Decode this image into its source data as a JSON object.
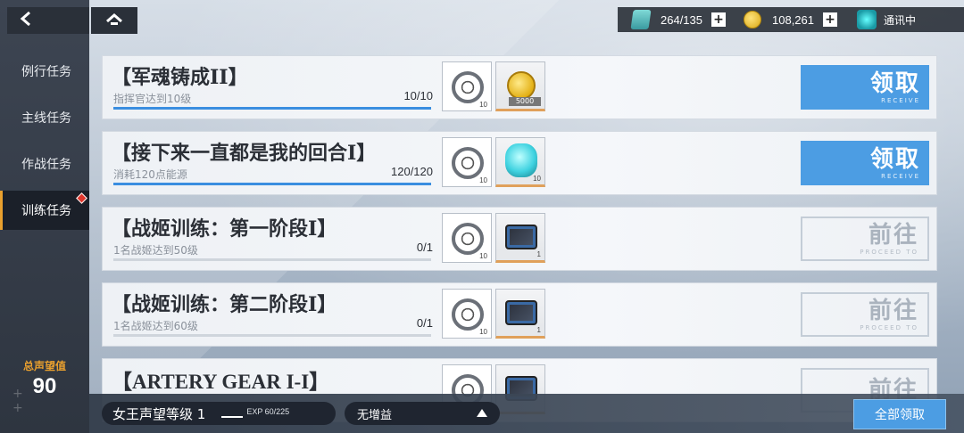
{
  "nav": {
    "back_icon": "chevron-left-icon",
    "home_icon": "chevron-up-icon",
    "items": [
      {
        "label": "例行任务",
        "active": false
      },
      {
        "label": "主线任务",
        "active": false
      },
      {
        "label": "作战任务",
        "active": false
      },
      {
        "label": "训练任务",
        "active": true
      }
    ],
    "prestige_label": "总声望值",
    "prestige_value": "90"
  },
  "resources": {
    "fuel": "264/135",
    "coins": "108,261",
    "comm": "通讯中"
  },
  "tasks": [
    {
      "title": "【军魂铸成II】",
      "desc": "指挥官达到10级",
      "count": "10/10",
      "progress": 1.0,
      "rewards": [
        {
          "icon": "exp-ring-icon",
          "qty": "10"
        },
        {
          "icon": "gold-coin-icon",
          "qty": "5000"
        }
      ],
      "action": "领取",
      "action_sub": "RECEIVE",
      "action_type": "receive"
    },
    {
      "title": "【接下来一直都是我的回合I】",
      "desc": "消耗120点能源",
      "count": "120/120",
      "progress": 1.0,
      "rewards": [
        {
          "icon": "exp-ring-icon",
          "qty": "10"
        },
        {
          "icon": "energy-core-icon",
          "qty": "10"
        }
      ],
      "action": "领取",
      "action_sub": "RECEIVE",
      "action_type": "receive"
    },
    {
      "title": "【战姬训练：第一阶段I】",
      "desc": "1名战姬达到50级",
      "count": "0/1",
      "progress": 0,
      "rewards": [
        {
          "icon": "exp-ring-icon",
          "qty": "10"
        },
        {
          "icon": "chip-icon",
          "qty": "1"
        }
      ],
      "action": "前往",
      "action_sub": "PROCEED TO",
      "action_type": "goto"
    },
    {
      "title": "【战姬训练：第二阶段I】",
      "desc": "1名战姬达到60级",
      "count": "0/1",
      "progress": 0,
      "rewards": [
        {
          "icon": "exp-ring-icon",
          "qty": "10"
        },
        {
          "icon": "chip-icon",
          "qty": "1"
        }
      ],
      "action": "前往",
      "action_sub": "PROCEED TO",
      "action_type": "goto"
    },
    {
      "title": "【ARTERY GEAR I-I】",
      "desc": "",
      "count": "",
      "progress": 0,
      "rewards": [
        {
          "icon": "exp-ring-icon",
          "qty": ""
        },
        {
          "icon": "chip-icon",
          "qty": ""
        }
      ],
      "action": "前往",
      "action_sub": "",
      "action_type": "goto"
    }
  ],
  "bottom": {
    "level": "女王声望等级 1",
    "exp": "EXP  60/225",
    "buff": "无增益",
    "buff_arrow": "triangle-up-icon",
    "claim_all": "全部领取"
  }
}
